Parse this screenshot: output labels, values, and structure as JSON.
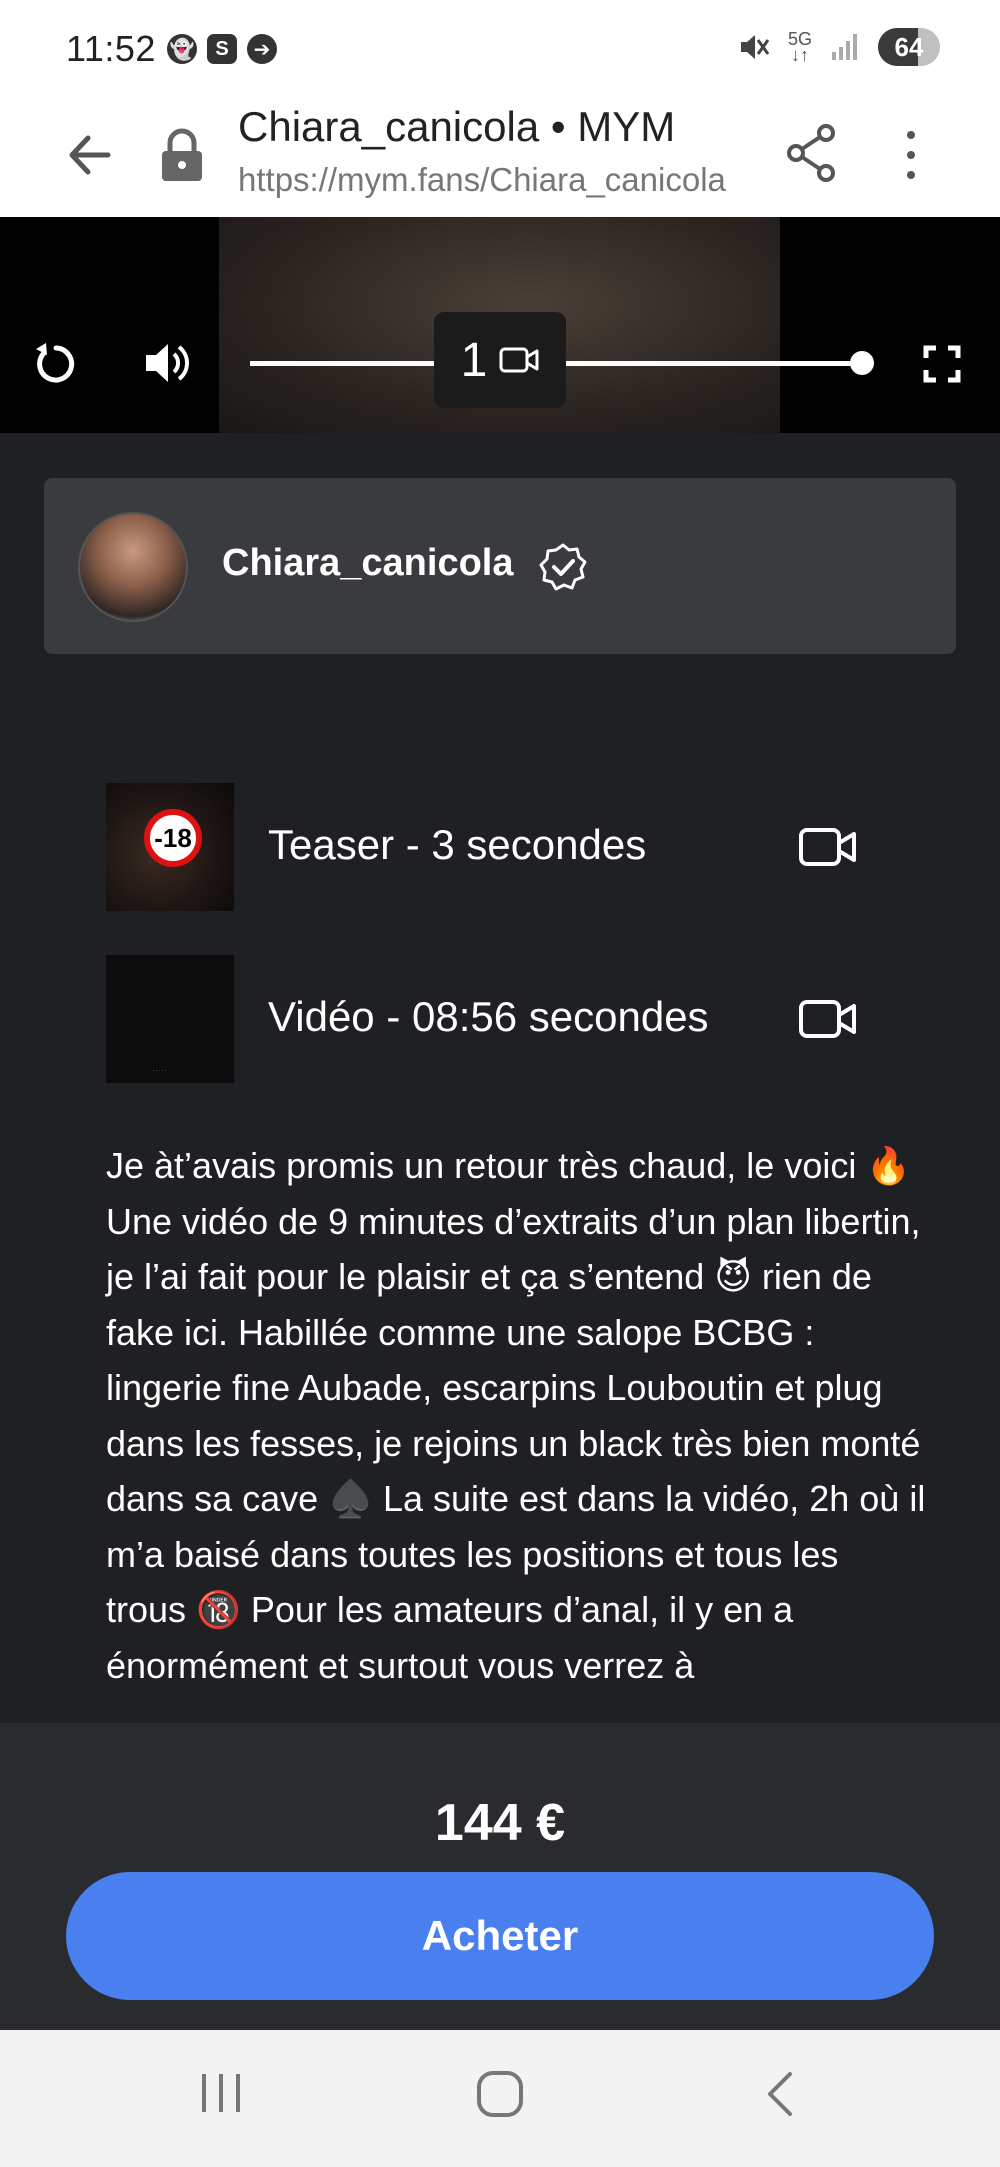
{
  "status_bar": {
    "time": "11:52",
    "network": "5G",
    "battery": "64",
    "battery_level": 0.64,
    "left_icons": [
      "snapchat-icon",
      "s-app-icon",
      "message-icon"
    ]
  },
  "browser": {
    "title": "Chiara_canicola • MYM",
    "url": "https://mym.fans/Chiara_canicola"
  },
  "player": {
    "media_count": "1",
    "progress": 1.0
  },
  "creator": {
    "name": "Chiara_canicola"
  },
  "items": [
    {
      "label": "Teaser - 3 secondes",
      "badge": "-18"
    },
    {
      "label": "Vidéo - 08:56 secondes"
    }
  ],
  "description": "Je àt’avais promis un retour très chaud, le voici 🔥 Une vidéo de 9 minutes d’extraits d’un plan libertin, je l’ai fait pour le plaisir et ça s’entend 😈 rien de fake ici. Habillée comme une salope BCBG : lingerie fine Aubade, escarpins Louboutin et plug dans les fesses, je rejoins un black très bien monté dans sa cave ♠️ La suite est dans la vidéo, 2h où il m’a baisé dans toutes les positions et tous les trous 🔞 Pour les amateurs d’anal, il y en a énormément et surtout vous verrez à",
  "purchase": {
    "price": "144 €",
    "button_label": "Acheter"
  },
  "colors": {
    "button": "#4a7ff0",
    "background": "#1f2023",
    "card": "#3a3b3e"
  }
}
